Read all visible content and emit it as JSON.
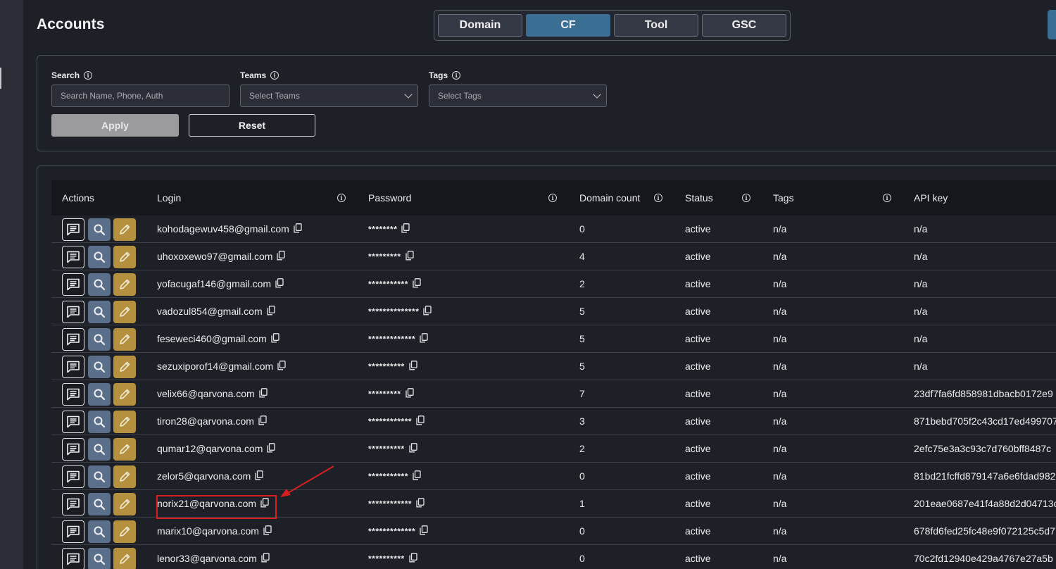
{
  "header": {
    "title": "Accounts",
    "tabs": [
      {
        "label": "Domain",
        "active": false
      },
      {
        "label": "CF",
        "active": true
      },
      {
        "label": "Tool",
        "active": false
      },
      {
        "label": "GSC",
        "active": false
      }
    ]
  },
  "filters": {
    "search": {
      "label": "Search",
      "placeholder": "Search Name, Phone, Auth"
    },
    "teams": {
      "label": "Teams",
      "placeholder": "Select Teams"
    },
    "tags": {
      "label": "Tags",
      "placeholder": "Select Tags"
    },
    "apply_label": "Apply",
    "reset_label": "Reset"
  },
  "table": {
    "columns": [
      "Actions",
      "Login",
      "Password",
      "Domain count",
      "Status",
      "Tags",
      "API key"
    ],
    "rows": [
      {
        "login": "kohodagewuv458@gmail.com",
        "password": "********",
        "domain_count": "0",
        "status": "active",
        "tags": "n/a",
        "api_key": "n/a"
      },
      {
        "login": "uhoxoxewo97@gmail.com",
        "password": "*********",
        "domain_count": "4",
        "status": "active",
        "tags": "n/a",
        "api_key": "n/a"
      },
      {
        "login": "yofacugaf146@gmail.com",
        "password": "***********",
        "domain_count": "2",
        "status": "active",
        "tags": "n/a",
        "api_key": "n/a"
      },
      {
        "login": "vadozul854@gmail.com",
        "password": "**************",
        "domain_count": "5",
        "status": "active",
        "tags": "n/a",
        "api_key": "n/a"
      },
      {
        "login": "feseweci460@gmail.com",
        "password": "*************",
        "domain_count": "5",
        "status": "active",
        "tags": "n/a",
        "api_key": "n/a"
      },
      {
        "login": "sezuxiporof14@gmail.com",
        "password": "**********",
        "domain_count": "5",
        "status": "active",
        "tags": "n/a",
        "api_key": "n/a"
      },
      {
        "login": "velix66@qarvona.com",
        "password": "*********",
        "domain_count": "7",
        "status": "active",
        "tags": "n/a",
        "api_key": "23df7fa6fd858981dbacb0172e9"
      },
      {
        "login": "tiron28@qarvona.com",
        "password": "************",
        "domain_count": "3",
        "status": "active",
        "tags": "n/a",
        "api_key": "871bebd705f2c43cd17ed499707"
      },
      {
        "login": "qumar12@qarvona.com",
        "password": "**********",
        "domain_count": "2",
        "status": "active",
        "tags": "n/a",
        "api_key": "2efc75e3a3c93c7d760bff8487c"
      },
      {
        "login": "zelor5@qarvona.com",
        "password": "***********",
        "domain_count": "0",
        "status": "active",
        "tags": "n/a",
        "api_key": "81bd21fcffd879147a6e6fdad982"
      },
      {
        "login": "norix21@qarvona.com",
        "password": "************",
        "domain_count": "1",
        "status": "active",
        "tags": "n/a",
        "api_key": "201eae0687e41f4a88d2d04713c"
      },
      {
        "login": "marix10@qarvona.com",
        "password": "*************",
        "domain_count": "0",
        "status": "active",
        "tags": "n/a",
        "api_key": "678fd6fed25fc48e9f072125c5d7"
      },
      {
        "login": "lenor33@qarvona.com",
        "password": "**********",
        "domain_count": "0",
        "status": "active",
        "tags": "n/a",
        "api_key": "70c2fd12940e429a4767e27a5b"
      }
    ]
  },
  "annotation": {
    "highlighted_row": 10,
    "color": "#d61f1f"
  },
  "colors": {
    "accent": "#3a6e93",
    "search_btn": "#5a6f8a",
    "edit_btn": "#b5913f",
    "apply_btn": "#9b9b9e"
  }
}
